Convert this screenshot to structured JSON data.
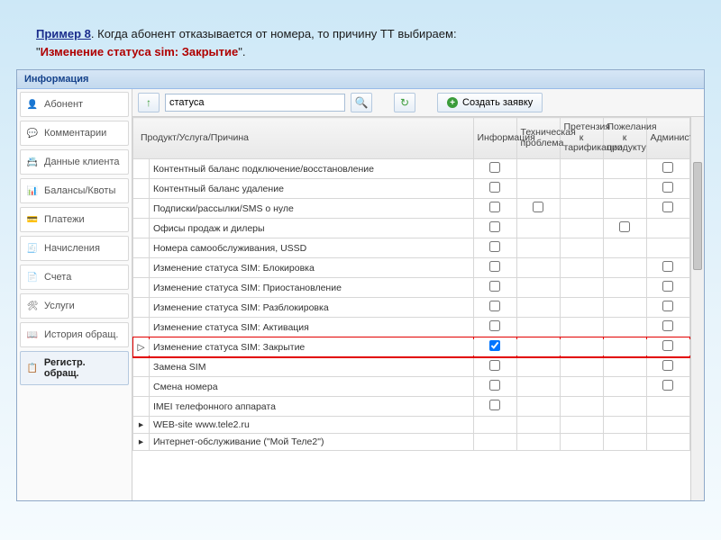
{
  "intro": {
    "example_label": "Пример 8",
    "text_after_label": ". Когда абонент отказывается от номера, то причину ТТ выбираем:",
    "quote_open": "\"",
    "highlight": "Изменение статуса sim: Закрытие",
    "quote_close": "\"."
  },
  "panel_title": "Информация",
  "sidebar": {
    "items": [
      {
        "label": "Абонент",
        "icon": "👤",
        "name": "sidebar-item-subscriber"
      },
      {
        "label": "Комментарии",
        "icon": "💬",
        "name": "sidebar-item-comments"
      },
      {
        "label": "Данные клиента",
        "icon": "📇",
        "name": "sidebar-item-client-data"
      },
      {
        "label": "Балансы/Квоты",
        "icon": "📊",
        "name": "sidebar-item-balances"
      },
      {
        "label": "Платежи",
        "icon": "💳",
        "name": "sidebar-item-payments"
      },
      {
        "label": "Начисления",
        "icon": "🧾",
        "name": "sidebar-item-charges"
      },
      {
        "label": "Счета",
        "icon": "📄",
        "name": "sidebar-item-accounts"
      },
      {
        "label": "Услуги",
        "icon": "🛠",
        "name": "sidebar-item-services"
      },
      {
        "label": "История обращ.",
        "icon": "📖",
        "name": "sidebar-item-history"
      },
      {
        "label": "Регистр. обращ.",
        "icon": "📋",
        "name": "sidebar-item-register",
        "active": true
      }
    ]
  },
  "toolbar": {
    "up_icon": "↑",
    "search_value": "статуса",
    "search_icon": "🔍",
    "refresh_icon": "↻",
    "create_label": "Создать заявку"
  },
  "grid": {
    "columns": {
      "product": "Продукт/Услуга/Причина",
      "info": "Информация",
      "tech": "Техническая проблема",
      "tariff": "Претензия к тарификации",
      "wish": "Пожелания к продукту",
      "admin": "Администрирование"
    },
    "rows": [
      {
        "name": "Контентный баланс подключение/восстановление",
        "arrow": "",
        "checks": [
          false,
          null,
          null,
          null,
          false
        ]
      },
      {
        "name": "Контентный баланс удаление",
        "arrow": "",
        "checks": [
          false,
          null,
          null,
          null,
          false
        ]
      },
      {
        "name": "Подписки/рассылки/SMS о нуле",
        "arrow": "",
        "checks": [
          false,
          false,
          null,
          null,
          false
        ]
      },
      {
        "name": "Офисы продаж и дилеры",
        "arrow": "",
        "checks": [
          false,
          null,
          null,
          false,
          null
        ]
      },
      {
        "name": "Номера самообслуживания, USSD",
        "arrow": "",
        "checks": [
          false,
          null,
          null,
          null,
          null
        ]
      },
      {
        "name": "Изменение статуса SIM: Блокировка",
        "arrow": "",
        "checks": [
          false,
          null,
          null,
          null,
          false
        ]
      },
      {
        "name": "Изменение статуса SIM: Приостановление",
        "arrow": "",
        "checks": [
          false,
          null,
          null,
          null,
          false
        ]
      },
      {
        "name": "Изменение статуса SIM: Разблокировка",
        "arrow": "",
        "checks": [
          false,
          null,
          null,
          null,
          false
        ]
      },
      {
        "name": "Изменение статуса SIM: Активация",
        "arrow": "",
        "checks": [
          false,
          null,
          null,
          null,
          false
        ]
      },
      {
        "name": "Изменение статуса SIM: Закрытие",
        "arrow": "▷",
        "checks": [
          true,
          null,
          null,
          null,
          false
        ],
        "highlight": true
      },
      {
        "name": "Замена SIM",
        "arrow": "",
        "checks": [
          false,
          null,
          null,
          null,
          false
        ]
      },
      {
        "name": "Смена номера",
        "arrow": "",
        "checks": [
          false,
          null,
          null,
          null,
          false
        ]
      },
      {
        "name": "IMEI телефонного аппарата",
        "arrow": "",
        "checks": [
          false,
          null,
          null,
          null,
          null
        ]
      },
      {
        "name": "WEB-site www.tele2.ru",
        "arrow": "▸",
        "checks": [
          null,
          null,
          null,
          null,
          null
        ]
      },
      {
        "name": "Интернет-обслуживание (\"Мой Теле2\")",
        "arrow": "▸",
        "checks": [
          null,
          null,
          null,
          null,
          null
        ]
      }
    ]
  }
}
